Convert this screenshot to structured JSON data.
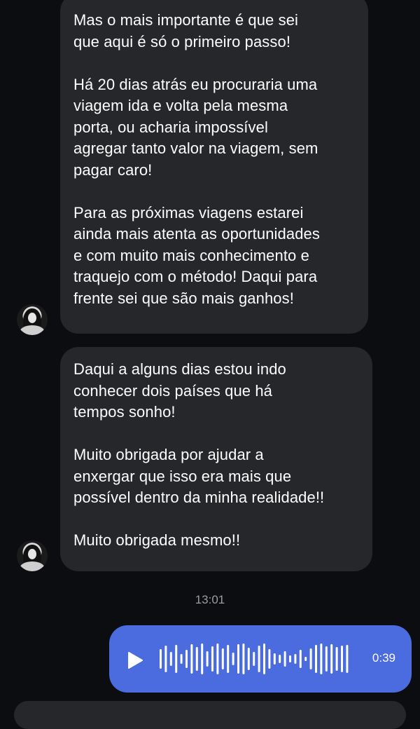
{
  "messages": [
    {
      "paragraphs": [
        "Mas o mais importante é que sei\nque aqui é só o primeiro passo!",
        "Há 20 dias atrás eu procuraria uma\nviagem ida e volta pela mesma\nporta, ou acharia impossível\nagregar tanto valor na viagem, sem\npagar caro!",
        "Para as próximas viagens estarei\nainda mais atenta as oportunidades\ne com muito mais conhecimento e\ntraquejo com o método! Daqui para\nfrente sei que são mais ganhos!"
      ]
    },
    {
      "paragraphs": [
        "Daqui a alguns dias estou indo\nconhecer dois países que há\ntempos sonho!",
        "Muito obrigada por ajudar a\nenxergar que isso era mais que\npossível dentro da minha realidade!!",
        "Muito obrigada mesmo!!"
      ]
    }
  ],
  "timestamp": "13:01",
  "voice_message": {
    "duration": "0:39",
    "play_icon": "play-icon",
    "bubble_color": "#4a6cdf"
  },
  "colors": {
    "background": "#0c0d10",
    "incoming_bubble": "#26272b",
    "timestamp_text": "#9b9ca1"
  }
}
